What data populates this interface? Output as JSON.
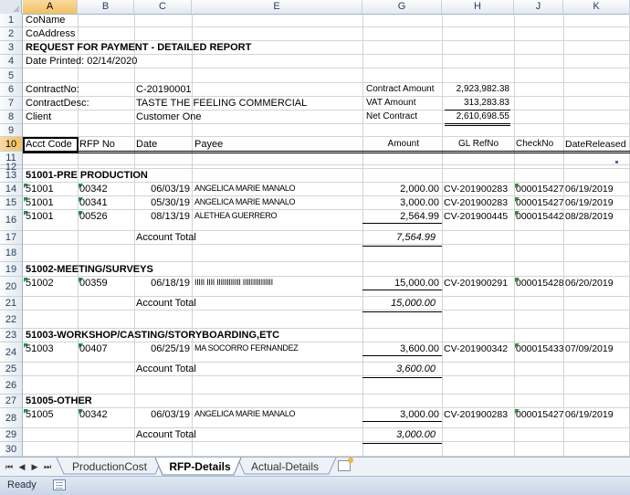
{
  "columns": {
    "a": "A",
    "b": "B",
    "c": "C",
    "e": "E",
    "g": "G",
    "h": "H",
    "j": "J",
    "k": "K"
  },
  "rows": [
    "1",
    "2",
    "3",
    "4",
    "5",
    "6",
    "7",
    "8",
    "9",
    "10",
    "11",
    "12",
    "13",
    "14",
    "15",
    "16",
    "17",
    "18",
    "19",
    "20",
    "21",
    "22",
    "23",
    "24",
    "25",
    "26",
    "27",
    "28",
    "29",
    "30"
  ],
  "report": {
    "co_name": "CoName",
    "co_address": "CoAddress",
    "title": "REQUEST FOR PAYMENT - DETAILED REPORT",
    "date_printed": "Date Printed:  02/14/2020"
  },
  "contract": {
    "no_label": "ContractNo:",
    "no_value": "C-20190001",
    "desc_label": "ContractDesc:",
    "desc_value": "TASTE THE FEELING COMMERCIAL",
    "client_label": "Client",
    "client_value": "Customer One",
    "amount_label": "Contract Amount",
    "amount_value": "2,923,982.38",
    "vat_label": "VAT Amount",
    "vat_value": "313,283.83",
    "net_label": "Net Contract",
    "net_value": "2,610,698.55"
  },
  "headers": {
    "acct": "Acct Code",
    "rfp": "RFP No",
    "date": "Date",
    "payee": "Payee",
    "amount": "Amount",
    "glref": "GL RefNo",
    "check": "CheckNo",
    "released": "DateReleased"
  },
  "groups": {
    "g1": {
      "title": "51001-PRE PRODUCTION",
      "rows": [
        {
          "acct": "51001",
          "rfp": "00342",
          "date": "06/03/19",
          "payee": "ANGELICA MARIE MANALO",
          "amount": "2,000.00",
          "gl": "CV-201900283",
          "check": "000015427",
          "released": "06/19/2019"
        },
        {
          "acct": "51001",
          "rfp": "00341",
          "date": "05/30/19",
          "payee": "ANGELICA MARIE MANALO",
          "amount": "3,000.00",
          "gl": "CV-201900283",
          "check": "000015427",
          "released": "06/19/2019"
        },
        {
          "acct": "51001",
          "rfp": "00526",
          "date": "08/13/19",
          "payee": "ALETHEA GUERRERO",
          "amount": "2,564.99",
          "gl": "CV-201900445",
          "check": "000015442",
          "released": "08/28/2019"
        }
      ],
      "total_label": "Account Total",
      "total": "7,564.99"
    },
    "g2": {
      "title": "51002-MEETING/SURVEYS",
      "rows": [
        {
          "acct": "51002",
          "rfp": "00359",
          "date": "06/18/19",
          "payee": "IIIII IIII IIIIIIIIIIII IIIIIIIIIIIIIII",
          "amount": "15,000.00",
          "gl": "CV-201900291",
          "check": "000015428",
          "released": "06/20/2019"
        }
      ],
      "total_label": "Account Total",
      "total": "15,000.00"
    },
    "g3": {
      "title": "51003-WORKSHOP/CASTING/STORYBOARDING,ETC",
      "rows": [
        {
          "acct": "51003",
          "rfp": "00407",
          "date": "06/25/19",
          "payee": "MA SOCORRO FERNANDEZ",
          "amount": "3,600.00",
          "gl": "CV-201900342",
          "check": "000015433",
          "released": "07/09/2019"
        }
      ],
      "total_label": "Account Total",
      "total": "3,600.00"
    },
    "g4": {
      "title": "51005-OTHER",
      "rows": [
        {
          "acct": "51005",
          "rfp": "00342",
          "date": "06/03/19",
          "payee": "ANGELICA MARIE MANALO",
          "amount": "3,000.00",
          "gl": "CV-201900283",
          "check": "000015427",
          "released": "06/19/2019"
        }
      ],
      "total_label": "Account Total",
      "total": "3,000.00"
    }
  },
  "tabs": {
    "t1": "ProductionCost",
    "t2": "RFP-Details",
    "t3": "Actual-Details"
  },
  "status": {
    "ready": "Ready"
  },
  "colors": {
    "header_bg": "#e4e9f0",
    "selected_header": "#f1c15f",
    "grid_line": "#d4d4d4",
    "comment_marker": "#1a9a3a"
  }
}
